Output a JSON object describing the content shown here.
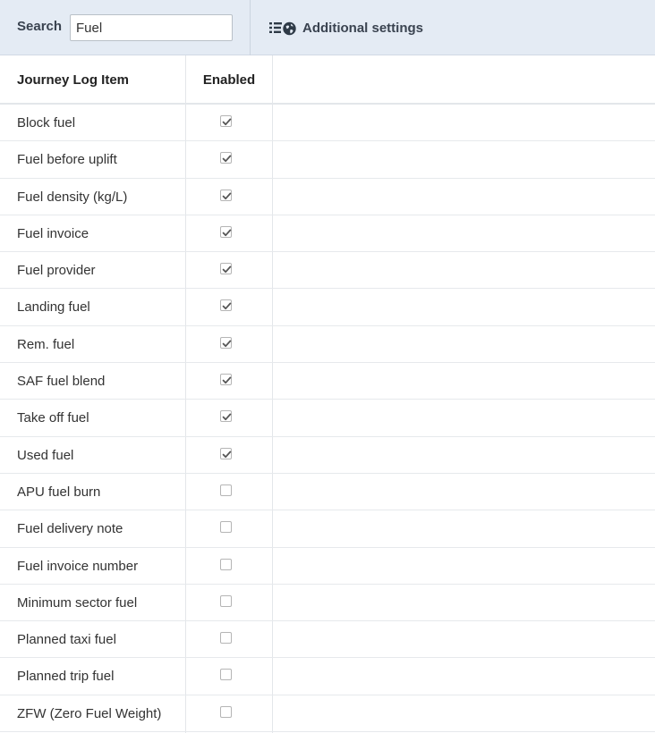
{
  "toolbar": {
    "search_label": "Search",
    "search_value": "Fuel",
    "settings_icon": "list-globe-icon",
    "settings_label": "Additional settings"
  },
  "table": {
    "headers": {
      "item": "Journey Log Item",
      "enabled": "Enabled"
    },
    "rows": [
      {
        "label": "Block fuel",
        "enabled": true
      },
      {
        "label": "Fuel before uplift",
        "enabled": true
      },
      {
        "label": "Fuel density (kg/L)",
        "enabled": true
      },
      {
        "label": "Fuel invoice",
        "enabled": true
      },
      {
        "label": "Fuel provider",
        "enabled": true
      },
      {
        "label": "Landing fuel",
        "enabled": true
      },
      {
        "label": "Rem. fuel",
        "enabled": true
      },
      {
        "label": "SAF fuel blend",
        "enabled": true
      },
      {
        "label": "Take off fuel",
        "enabled": true
      },
      {
        "label": "Used fuel",
        "enabled": true
      },
      {
        "label": "APU fuel burn",
        "enabled": false
      },
      {
        "label": "Fuel delivery note",
        "enabled": false
      },
      {
        "label": "Fuel invoice number",
        "enabled": false
      },
      {
        "label": "Minimum sector fuel",
        "enabled": false
      },
      {
        "label": "Planned taxi fuel",
        "enabled": false
      },
      {
        "label": "Planned trip fuel",
        "enabled": false
      },
      {
        "label": "ZFW (Zero Fuel Weight)",
        "enabled": false
      }
    ]
  }
}
